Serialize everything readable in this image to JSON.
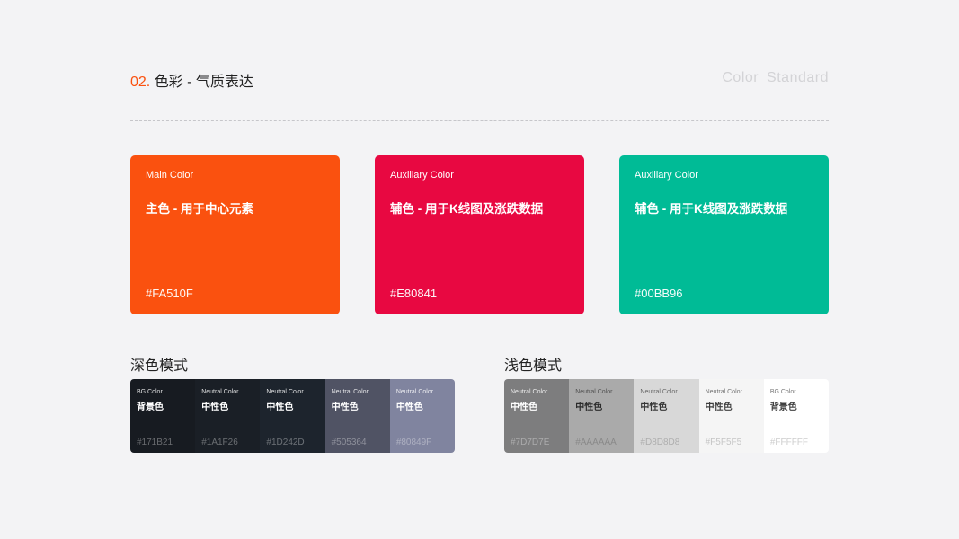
{
  "header": {
    "number": "02.",
    "title": "色彩 - 气质表达",
    "subtitle": "Color Standard"
  },
  "cards": [
    {
      "label": "Main Color",
      "desc": "主色 - 用于中心元素",
      "hex": "#FA510F",
      "color": "#FA510F"
    },
    {
      "label": "Auxiliary Color",
      "desc": "辅色 - 用于K线图及涨跌数据",
      "hex": "#E80841",
      "color": "#E80841"
    },
    {
      "label": "Auxiliary Color",
      "desc": "辅色 - 用于K线图及涨跌数据",
      "hex": "#00BB96",
      "color": "#00BB96"
    }
  ],
  "dark_mode": {
    "title": "深色模式",
    "swatches": [
      {
        "label": "BG  Color",
        "name": "背景色",
        "hex": "#171B21",
        "color": "#171B21"
      },
      {
        "label": "Neutral Color",
        "name": "中性色",
        "hex": "#1A1F26",
        "color": "#1A1F26"
      },
      {
        "label": "Neutral Color",
        "name": "中性色",
        "hex": "#1D242D",
        "color": "#1D242D"
      },
      {
        "label": "Neutral Color",
        "name": "中性色",
        "hex": "#505364",
        "color": "#505364"
      },
      {
        "label": "Neutral Color",
        "name": "中性色",
        "hex": "#80849F",
        "color": "#80849F"
      }
    ]
  },
  "light_mode": {
    "title": "浅色模式",
    "swatches": [
      {
        "label": "Neutral Color",
        "name": "中性色",
        "hex": "#7D7D7E",
        "color": "#7D7D7E"
      },
      {
        "label": "Neutral Color",
        "name": "中性色",
        "hex": "#AAAAAA",
        "color": "#AAAAAA"
      },
      {
        "label": "Neutral Color",
        "name": "中性色",
        "hex": "#D8D8D8",
        "color": "#D8D8D8"
      },
      {
        "label": "Neutral Color",
        "name": "中性色",
        "hex": "#F5F5F5",
        "color": "#F5F5F5"
      },
      {
        "label": "BG  Color",
        "name": "背景色",
        "hex": "#FFFFFF",
        "color": "#FFFFFF"
      }
    ]
  }
}
